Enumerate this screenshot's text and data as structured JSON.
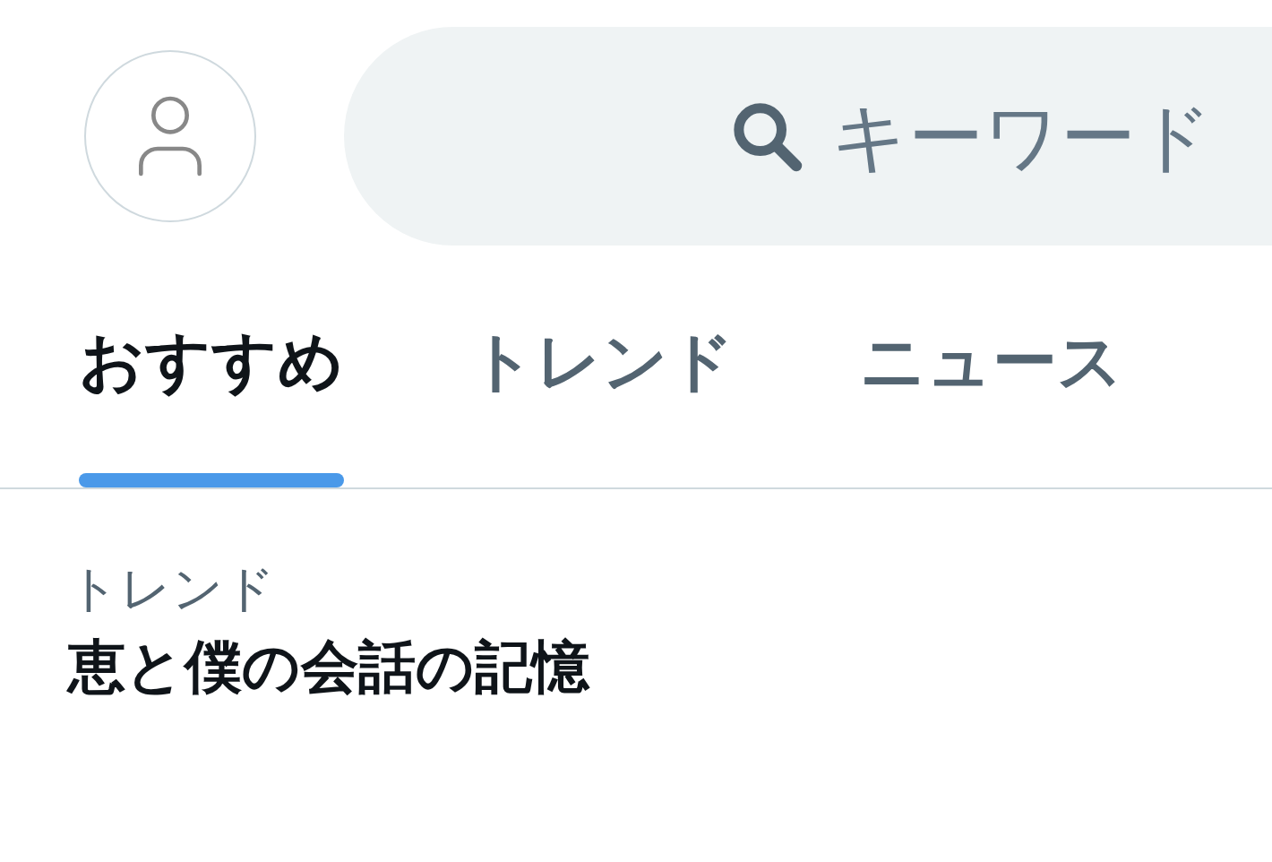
{
  "search": {
    "placeholder": "キーワード"
  },
  "tabs": [
    {
      "label": "おすすめ",
      "selected": true
    },
    {
      "label": "トレンド",
      "selected": false
    },
    {
      "label": "ニュース",
      "selected": false
    }
  ],
  "trend": {
    "category": "トレンド",
    "title": "恵と僕の会話の記憶"
  }
}
